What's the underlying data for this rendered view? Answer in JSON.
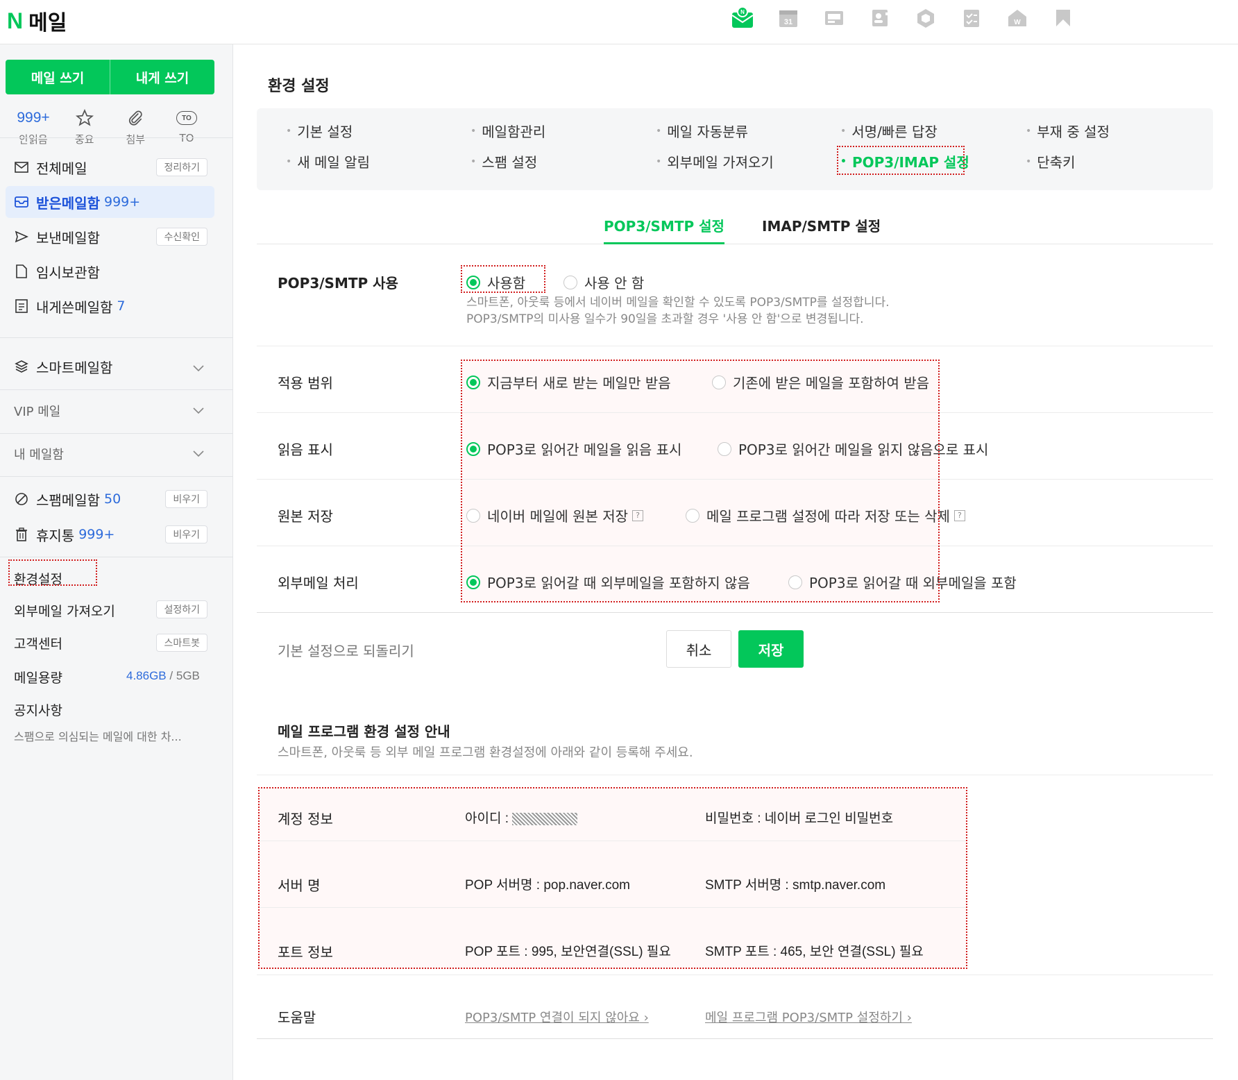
{
  "app": {
    "logo_mark": "N",
    "title": "메일"
  },
  "top_apps": [
    "mail-app-icon",
    "calendar-app-icon",
    "contact-card-app-icon",
    "address-book-app-icon",
    "mybox-app-icon",
    "todo-app-icon",
    "office-app-icon",
    "bookmark-app-icon"
  ],
  "calendar_day": "31",
  "sidebar": {
    "write_mail": "메일 쓰기",
    "write_to_me": "내게 쓰기",
    "quick": {
      "unread_count": "999+",
      "unread": "안읽음",
      "important": "중요",
      "attachment": "첨부",
      "to_badge": "TO",
      "to": "TO"
    },
    "all_mail": {
      "label": "전체메일",
      "action": "정리하기"
    },
    "inbox": {
      "label": "받은메일함",
      "count": "999+"
    },
    "sent": {
      "label": "보낸메일함",
      "action": "수신확인"
    },
    "drafts": {
      "label": "임시보관함"
    },
    "to_me": {
      "label": "내게쓴메일함",
      "count": "7"
    },
    "smart": {
      "label": "스마트메일함"
    },
    "vip": {
      "label": "VIP 메일"
    },
    "my_folders": {
      "label": "내 메일함"
    },
    "spam": {
      "label": "스팸메일함",
      "count": "50",
      "action": "비우기"
    },
    "trash": {
      "label": "휴지통",
      "count": "999+",
      "action": "비우기"
    },
    "settings": "환경설정",
    "external": {
      "label": "외부메일 가져오기",
      "action": "설정하기"
    },
    "support": {
      "label": "고객센터",
      "action": "스마트봇"
    },
    "quota": {
      "label": "메일용량",
      "used": "4.86GB",
      "sep": "/",
      "total": "5GB"
    },
    "notice": {
      "label": "공지사항",
      "text": "스팸으로 의심되는 메일에 대한 차..."
    }
  },
  "main": {
    "title": "환경 설정",
    "menu": {
      "basic": "기본 설정",
      "folders": "메일함관리",
      "autosort": "메일 자동분류",
      "signature": "서명/빠른 답장",
      "away": "부재 중 설정",
      "notify": "새 메일 알림",
      "spam": "스팸 설정",
      "external": "외부메일 가져오기",
      "pop3imap": "POP3/IMAP 설정",
      "shortcuts": "단축키"
    },
    "tabs": {
      "pop3": "POP3/SMTP 설정",
      "imap": "IMAP/SMTP 설정"
    },
    "use": {
      "label": "POP3/SMTP 사용",
      "on": "사용함",
      "off": "사용 안 함",
      "desc1": "스마트폰, 아웃룩 등에서 네이버 메일을 확인할 수 있도록 POP3/SMTP를 설정합니다.",
      "desc2": "POP3/SMTP의 미사용 일수가 90일을 초과할 경우 '사용 안 함'으로 변경됩니다."
    },
    "scope": {
      "label": "적용 범위",
      "opt1": "지금부터 새로 받는 메일만 받음",
      "opt2": "기존에 받은 메일을 포함하여 받음"
    },
    "read": {
      "label": "읽음 표시",
      "opt1": "POP3로 읽어간 메일을 읽음 표시",
      "opt2": "POP3로 읽어간 메일을 읽지 않음으로 표시"
    },
    "original": {
      "label": "원본 저장",
      "opt1": "네이버 메일에 원본 저장",
      "opt2": "메일 프로그램 설정에 따라 저장 또는 삭제",
      "help": "?"
    },
    "external": {
      "label": "외부메일 처리",
      "opt1": "POP3로 읽어갈 때 외부메일을 포함하지 않음",
      "opt2": "POP3로 읽어갈 때 외부메일을 포함"
    },
    "reset": "기본 설정으로 되돌리기",
    "cancel": "취소",
    "save": "저장",
    "guide": {
      "title": "메일 프로그램 환경 설정 안내",
      "sub": "스마트폰, 아웃룩 등 외부 메일 프로그램 환경설정에 아래와 같이 등록해 주세요.",
      "account": {
        "label": "계정 정보",
        "id": "아이디 : ",
        "pw": "비밀번호 : 네이버 로그인 비밀번호"
      },
      "server": {
        "label": "서버 명",
        "pop": "POP 서버명 : pop.naver.com",
        "smtp": "SMTP 서버명 : smtp.naver.com"
      },
      "port": {
        "label": "포트 정보",
        "pop": "POP 포트 : 995, 보안연결(SSL) 필요",
        "smtp": "SMTP 포트 : 465, 보안 연결(SSL) 필요"
      },
      "help": {
        "label": "도움말",
        "link1": "POP3/SMTP 연결이 되지 않아요",
        "link2": "메일 프로그램 POP3/SMTP 설정하기"
      }
    }
  },
  "colors": {
    "brand": "#03c75a",
    "link": "#2d6bdb",
    "highlight": "#d11c1c"
  }
}
